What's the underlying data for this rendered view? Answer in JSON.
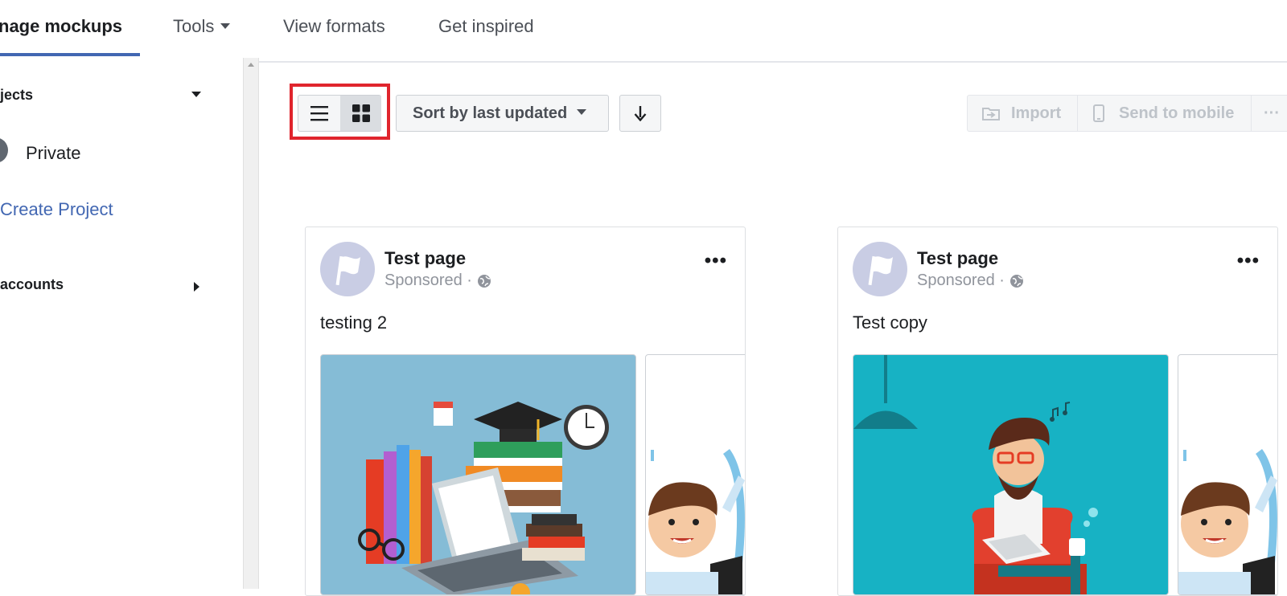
{
  "topnav": {
    "tabs": [
      {
        "label": "nage mockups"
      },
      {
        "label": "Tools"
      },
      {
        "label": "View formats"
      },
      {
        "label": "Get inspired"
      }
    ],
    "accent_color": "#4267b2"
  },
  "sidebar": {
    "projects_header": "jects",
    "private_label": "Private",
    "create_project": "Create Project",
    "accounts_header": "accounts"
  },
  "toolbar": {
    "sort_label": "Sort by last updated",
    "import_label": "Import",
    "send_to_mobile_label": "Send to mobile",
    "more_label": "···",
    "highlight_color": "#e0252d"
  },
  "cards": [
    {
      "page_name": "Test page",
      "sponsored": "Sponsored ·",
      "text": "testing 2"
    },
    {
      "page_name": "Test page",
      "sponsored": "Sponsored ·",
      "text": "Test copy"
    }
  ]
}
